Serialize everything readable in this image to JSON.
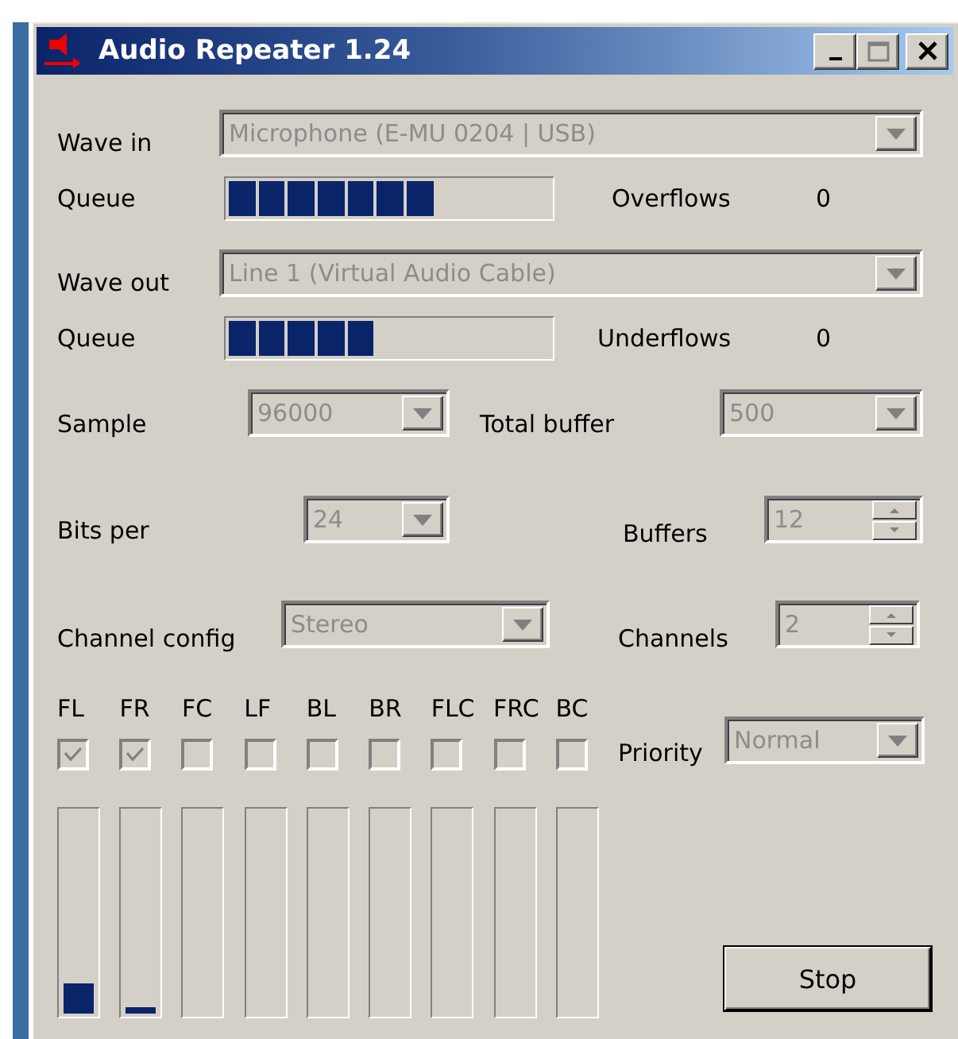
{
  "window": {
    "title": "Audio Repeater 1.24"
  },
  "wave_in": {
    "label": "Wave in",
    "kind": "combo",
    "value": "Microphone (E-MU 0204 | USB)",
    "disabled": true
  },
  "queue_in": {
    "label": "Queue",
    "level": 0.64,
    "counter_label": "Overflows",
    "counter": "0"
  },
  "wave_out": {
    "label": "Wave out",
    "kind": "combo",
    "value": "Line 1 (Virtual Audio Cable)",
    "disabled": true
  },
  "queue_out": {
    "label": "Queue",
    "level": 0.45,
    "counter_label": "Underflows",
    "counter": "0"
  },
  "sample": {
    "label": "Sample",
    "kind": "combo",
    "value": "96000",
    "disabled": true
  },
  "total_buffer": {
    "label": "Total buffer",
    "kind": "combo",
    "value": "500",
    "disabled": true
  },
  "bits_per": {
    "label": "Bits per",
    "kind": "combo",
    "value": "24",
    "disabled": true
  },
  "buffers": {
    "label": "Buffers",
    "kind": "spin",
    "value": "12",
    "disabled": true
  },
  "channel_config": {
    "label": "Channel config",
    "kind": "combo",
    "value": "Stereo",
    "disabled": true
  },
  "channels": {
    "label": "Channels",
    "kind": "spin",
    "value": "2",
    "disabled": true
  },
  "speakers": [
    {
      "label": "FL",
      "checked": true,
      "level": 0.15
    },
    {
      "label": "FR",
      "checked": true,
      "level": 0.03
    },
    {
      "label": "FC",
      "checked": false
    },
    {
      "label": "LF",
      "checked": false
    },
    {
      "label": "BL",
      "checked": false
    },
    {
      "label": "BR",
      "checked": false
    },
    {
      "label": "FLC",
      "checked": false
    },
    {
      "label": "FRC",
      "checked": false
    },
    {
      "label": "BC",
      "checked": false
    }
  ],
  "priority": {
    "label": "Priority",
    "kind": "combo",
    "value": "Normal",
    "disabled": true
  },
  "stop_button": {
    "label": "Stop"
  }
}
